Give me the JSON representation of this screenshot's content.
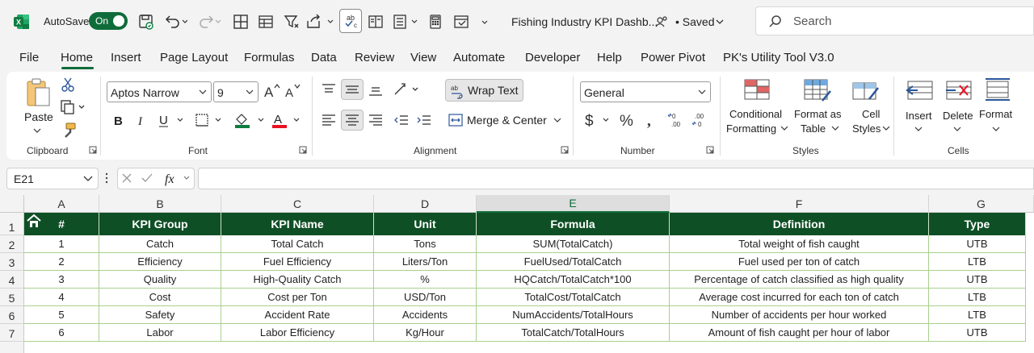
{
  "titlebar": {
    "autosave_label": "AutoSave",
    "autosave_state": "On",
    "document_title": "Fishing Industry KPI Dashb...",
    "saved_status": "• Saved",
    "search_placeholder": "Search"
  },
  "tabs": [
    "File",
    "Home",
    "Insert",
    "Page Layout",
    "Formulas",
    "Data",
    "Review",
    "View",
    "Automate",
    "Developer",
    "Help",
    "Power Pivot",
    "PK's Utility Tool V3.0"
  ],
  "active_tab": "Home",
  "ribbon": {
    "clipboard": {
      "paste_label": "Paste",
      "group_label": "Clipboard"
    },
    "font": {
      "font_name": "Aptos Narrow",
      "font_size": "9",
      "group_label": "Font"
    },
    "alignment": {
      "wrap_text": "Wrap Text",
      "merge_center": "Merge & Center",
      "group_label": "Alignment"
    },
    "number": {
      "format": "General",
      "group_label": "Number"
    },
    "styles": {
      "conditional_1": "Conditional",
      "conditional_2": "Formatting",
      "format_as_1": "Format as",
      "format_as_2": "Table",
      "cell_styles_1": "Cell",
      "cell_styles_2": "Styles",
      "group_label": "Styles"
    },
    "cells": {
      "insert": "Insert",
      "delete": "Delete",
      "format": "Format",
      "group_label": "Cells"
    }
  },
  "formula_bar": {
    "name_box": "E21",
    "formula": ""
  },
  "grid": {
    "columns": [
      "A",
      "B",
      "C",
      "D",
      "E",
      "F",
      "G"
    ],
    "selected_column": "E",
    "row_numbers": [
      "1",
      "2",
      "3",
      "4",
      "5",
      "6",
      "7"
    ],
    "headers": [
      "#",
      "KPI Group",
      "KPI Name",
      "Unit",
      "Formula",
      "Definition",
      "Type"
    ],
    "rows": [
      [
        "1",
        "Catch",
        "Total Catch",
        "Tons",
        "SUM(TotalCatch)",
        "Total weight of fish caught",
        "UTB"
      ],
      [
        "2",
        "Efficiency",
        "Fuel Efficiency",
        "Liters/Ton",
        "FuelUsed/TotalCatch",
        "Fuel used per ton of catch",
        "LTB"
      ],
      [
        "3",
        "Quality",
        "High-Quality Catch",
        "%",
        "HQCatch/TotalCatch*100",
        "Percentage of catch classified as high quality",
        "UTB"
      ],
      [
        "4",
        "Cost",
        "Cost per Ton",
        "USD/Ton",
        "TotalCost/TotalCatch",
        "Average cost incurred for each ton of catch",
        "LTB"
      ],
      [
        "5",
        "Safety",
        "Accident Rate",
        "Accidents",
        "NumAccidents/TotalHours",
        "Number of accidents per hour worked",
        "LTB"
      ],
      [
        "6",
        "Labor",
        "Labor Efficiency",
        "Kg/Hour",
        "TotalCatch/TotalHours",
        "Amount of fish caught per hour of labor",
        "UTB"
      ]
    ]
  },
  "colors": {
    "header_fill": "#0f4f25",
    "border": "#a9d08e",
    "accent": "#0f6c3a"
  }
}
